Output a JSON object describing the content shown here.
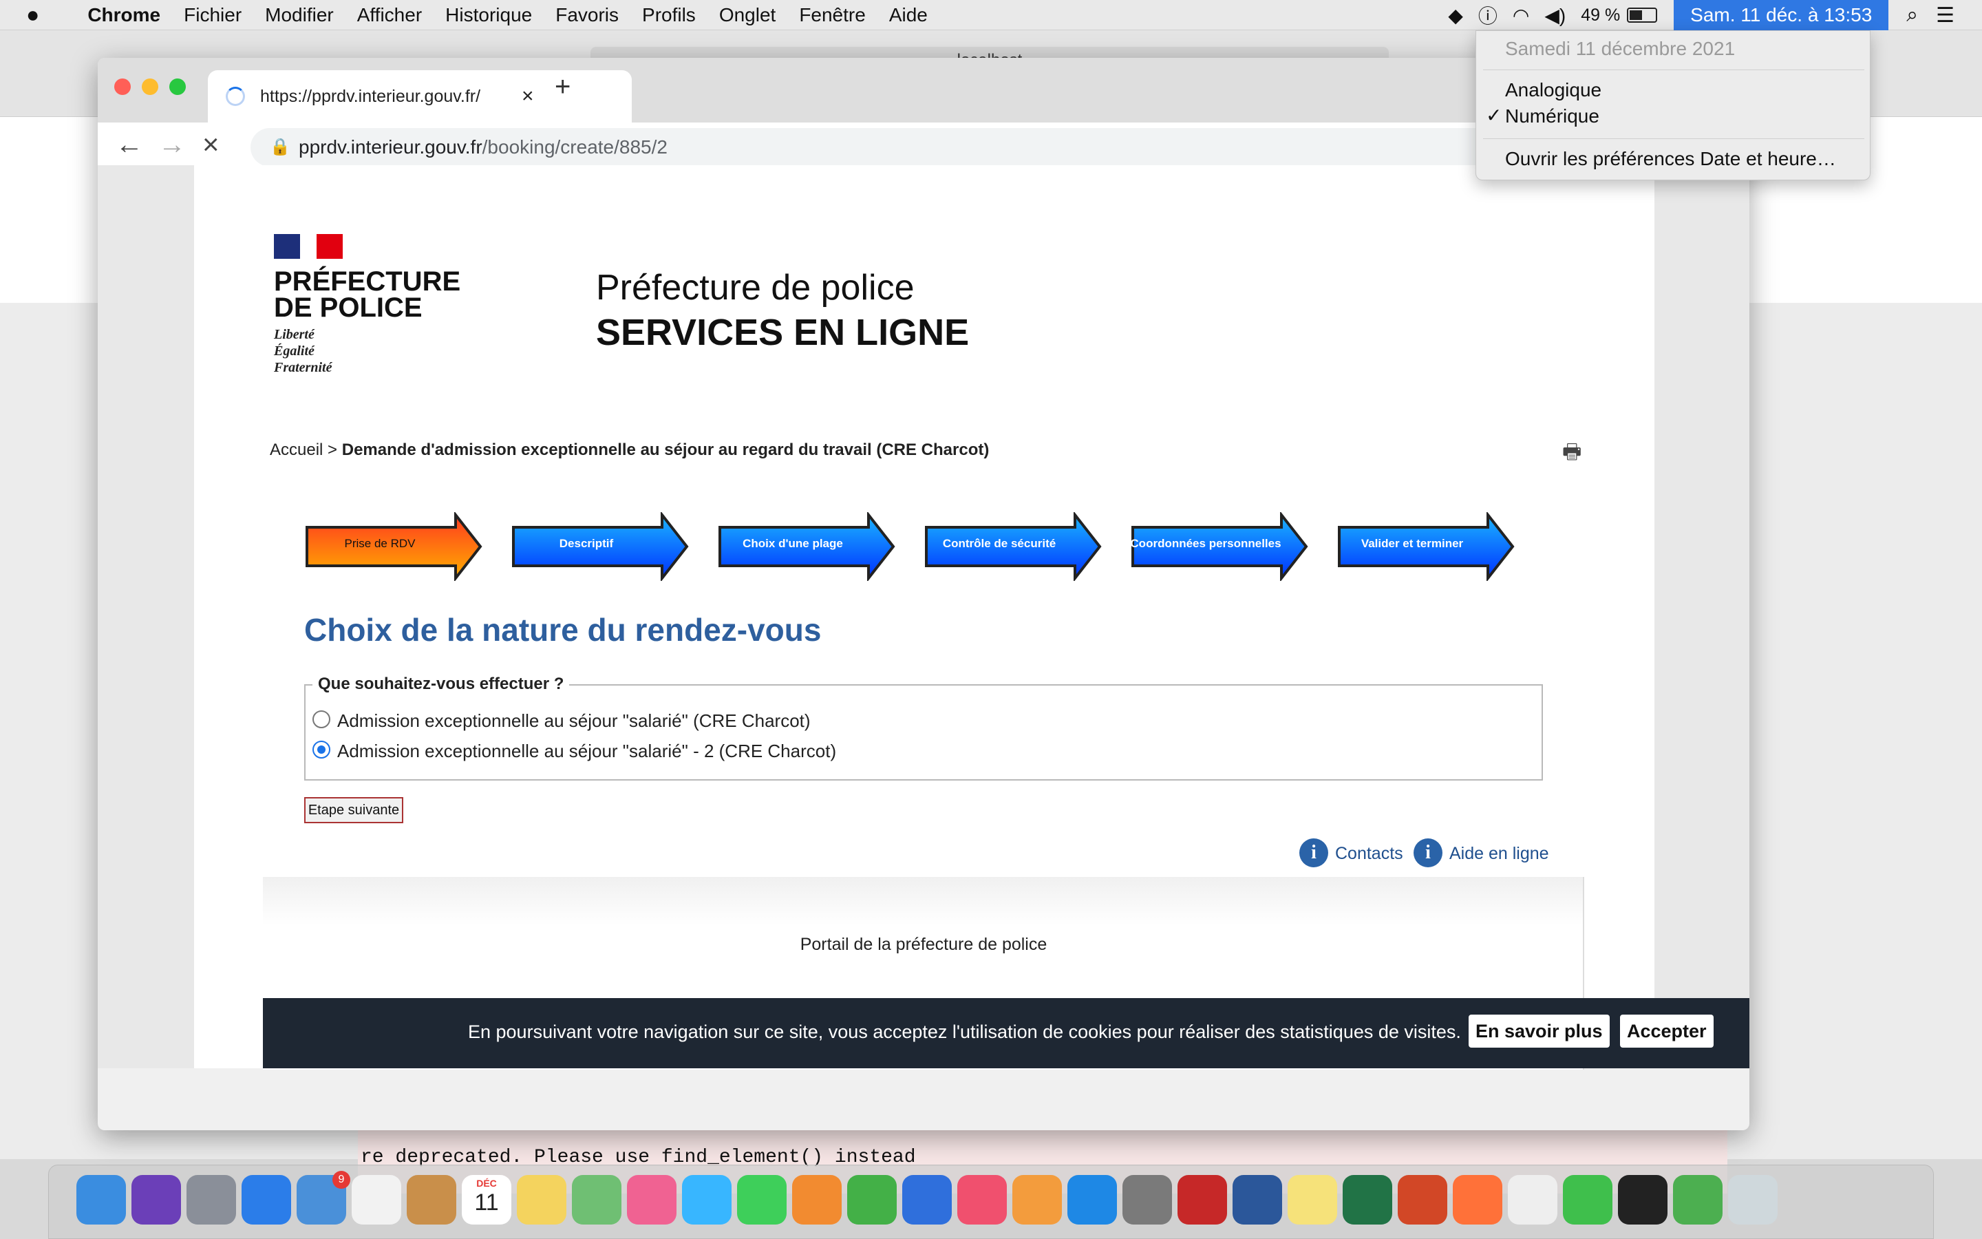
{
  "menubar": {
    "app": "Chrome",
    "items": [
      "Fichier",
      "Modifier",
      "Afficher",
      "Historique",
      "Favoris",
      "Profils",
      "Onglet",
      "Fenêtre",
      "Aide"
    ],
    "battery": "49 %",
    "clock": "Sam. 11 déc. à  13:53"
  },
  "clock_menu": {
    "date": "Samedi 11 décembre 2021",
    "analog": "Analogique",
    "digital": "Numérique",
    "check": "✓",
    "prefs": "Ouvrir les préférences Date et heure…"
  },
  "background_window": {
    "title": "localhost",
    "terminal_line": "re deprecated. Please use find_element() instead"
  },
  "browser": {
    "tab_title": "https://pprdv.interieur.gouv.fr/",
    "url_host": "pprdv.interieur.gouv.fr",
    "url_path": "/booking/create/885/2"
  },
  "page": {
    "logo": {
      "line1": "PRÉFECTURE",
      "line2": "DE POLICE",
      "motto1": "Liberté",
      "motto2": "Égalité",
      "motto3": "Fraternité"
    },
    "header_line1": "Préfecture de police",
    "header_line2": "SERVICES EN LIGNE",
    "breadcrumb_home": "Accueil",
    "breadcrumb_sep": ">",
    "breadcrumb_current": "Demande d'admission exceptionnelle au séjour au regard du travail (CRE Charcot)",
    "steps": [
      "Prise de RDV",
      "Descriptif",
      "Choix d'une plage",
      "Contrôle de sécurité",
      "Coordonnées personnelles",
      "Valider et terminer"
    ],
    "title": "Choix de la nature du rendez-vous",
    "question": "Que souhaitez-vous effectuer ?",
    "options": [
      "Admission exceptionnelle au séjour \"salarié\" (CRE Charcot)",
      "Admission exceptionnelle au séjour \"salarié\" - 2 (CRE Charcot)"
    ],
    "selected_option": 1,
    "next_button": "Etape suivante",
    "contacts": "Contacts",
    "help": "Aide en ligne",
    "footer": "Portail de la préfecture de police"
  },
  "cookie": {
    "message": "En poursuivant votre navigation sur ce site, vous acceptez l'utilisation de cookies pour réaliser des statistiques de visites.",
    "more": "En savoir plus",
    "accept": "Accepter"
  },
  "dock": {
    "calendar_month": "DÉC",
    "calendar_day": "11",
    "mail_badge": "9",
    "icons": [
      "finder-icon",
      "siri-icon",
      "launchpad-icon",
      "safari-icon",
      "mail-icon",
      "reminders-icon",
      "contacts-icon",
      "calendar-icon",
      "notes-icon",
      "maps-icon",
      "photos-icon",
      "messages-icon",
      "facetime-icon",
      "pages-icon",
      "numbers-icon",
      "keynote-icon",
      "music-icon",
      "books-icon",
      "app-store-icon",
      "system-preferences-icon",
      "zotero-icon",
      "word-icon",
      "stickies-icon",
      "excel-icon",
      "powerpoint-icon",
      "firefox-icon",
      "textedit-icon",
      "green-ring-icon",
      "terminal-icon",
      "chrome-icon",
      "trash-icon"
    ]
  }
}
